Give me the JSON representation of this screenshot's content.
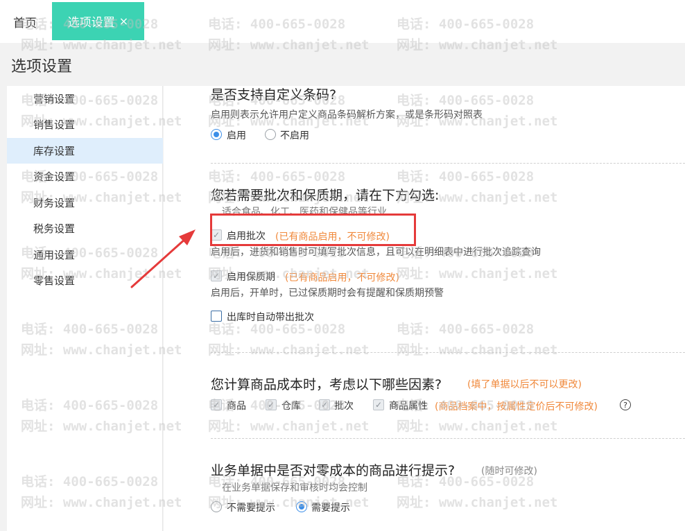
{
  "tabs": {
    "home": "首页",
    "active": "选项设置",
    "close": "×"
  },
  "page_title": "选项设置",
  "sidebar": {
    "items": [
      {
        "label": "营销设置"
      },
      {
        "label": "销售设置"
      },
      {
        "label": "库存设置",
        "active": true
      },
      {
        "label": "资金设置"
      },
      {
        "label": "财务设置"
      },
      {
        "label": "税务设置"
      },
      {
        "label": "通用设置"
      },
      {
        "label": "零售设置"
      }
    ]
  },
  "sections": {
    "barcode": {
      "title": "是否支持自定义条码?",
      "desc": "启用则表示允许用户定义商品条码解析方案，或是条形码对照表",
      "option_on": "启用",
      "option_off": "不启用",
      "selected": "启用"
    },
    "batch": {
      "title": "您若需要批次和保质期，请在下方勾选:",
      "subtitle": "适合食品、化工、医药和保健品等行业",
      "batch_label": "启用批次",
      "batch_hint": "(已有商品启用，不可修改)",
      "batch_desc": "启用后，进货和销售时可填写批次信息，且可以在明细表中进行批次追踪查询",
      "shelf_label": "启用保质期",
      "shelf_hint": "(已有商品启用，不可修改)",
      "shelf_desc": "启用后，开单时，已过保质期时会有提醒和保质期预警",
      "auto_label": "出库时自动带出批次"
    },
    "cost": {
      "title": "您计算商品成本时，考虑以下哪些因素?",
      "hint": "(填了单据以后不可以更改)",
      "items": [
        "商品",
        "仓库",
        "批次",
        "商品属性"
      ],
      "attr_hint": "(商品档案中，按属性定价后不可修改)",
      "help": "?"
    },
    "zero_cost": {
      "title": "业务单据中是否对零成本的商品进行提示?",
      "hint": "(随时可修改)",
      "subtitle": "在业务单据保存和审核时均会控制",
      "option_no": "不需要提示",
      "option_yes": "需要提示",
      "selected": "需要提示"
    }
  },
  "watermark": {
    "phone": "电话: 400-665-0028",
    "site": "网址: www.chanjet.net"
  },
  "colors": {
    "tab_active": "#3cd3b3",
    "nav_active": "#dfeefc",
    "hint_orange": "#f0883a",
    "radio_blue": "#3b8ee8",
    "annotation_red": "#e53a3a"
  }
}
